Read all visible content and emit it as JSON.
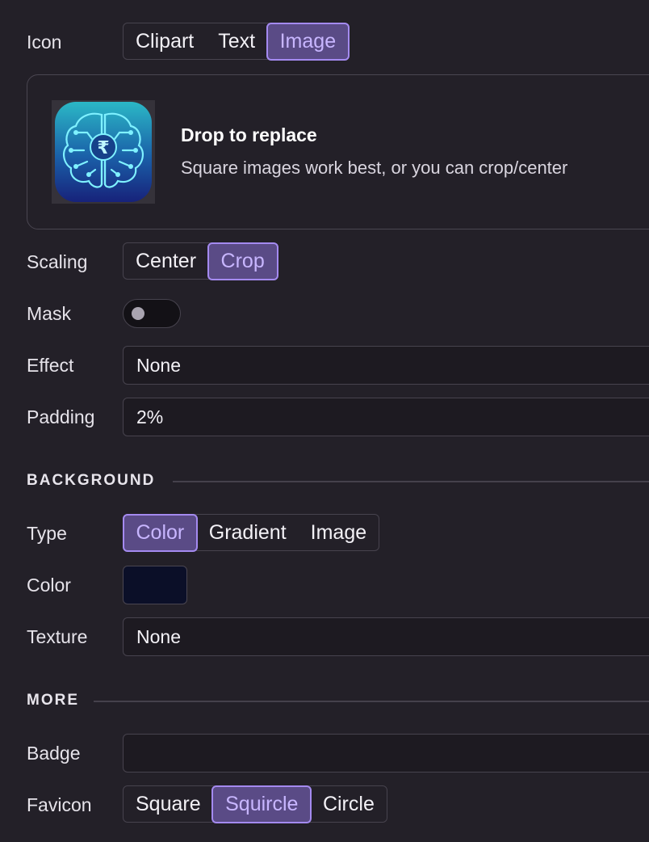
{
  "icon": {
    "label": "Icon",
    "options": [
      "Clipart",
      "Text",
      "Image"
    ],
    "selected": "Image"
  },
  "drop": {
    "title": "Drop to replace",
    "subtitle": "Square images work best, or you can crop/center",
    "image_icon": "brain-rupee-icon"
  },
  "scaling": {
    "label": "Scaling",
    "options": [
      "Center",
      "Crop"
    ],
    "selected": "Crop"
  },
  "mask": {
    "label": "Mask",
    "enabled": false
  },
  "effect": {
    "label": "Effect",
    "value": "None"
  },
  "padding": {
    "label": "Padding",
    "value": "2%"
  },
  "background": {
    "section_title": "BACKGROUND",
    "type": {
      "label": "Type",
      "options": [
        "Color",
        "Gradient",
        "Image"
      ],
      "selected": "Color"
    },
    "color": {
      "label": "Color",
      "value": "#0b0f28"
    },
    "texture": {
      "label": "Texture",
      "value": "None"
    }
  },
  "more": {
    "section_title": "MORE",
    "badge": {
      "label": "Badge",
      "value": ""
    },
    "favicon": {
      "label": "Favicon",
      "options": [
        "Square",
        "Squircle",
        "Circle"
      ],
      "selected": "Squircle"
    }
  },
  "colors": {
    "background": "#232028",
    "accent": "#a48af0",
    "accent_fill": "#5a4b86"
  }
}
